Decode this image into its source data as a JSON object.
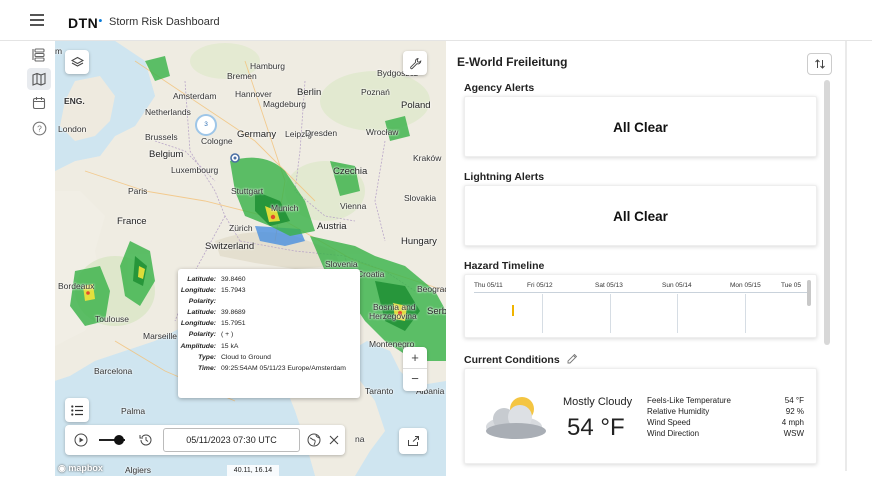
{
  "app": {
    "logo": "DTN",
    "title": "Storm Risk Dashboard"
  },
  "nav": {
    "items": [
      {
        "icon": "layers-list-icon"
      },
      {
        "icon": "map-icon",
        "active": true
      },
      {
        "icon": "calendar-icon"
      },
      {
        "icon": "help-icon"
      }
    ]
  },
  "map": {
    "labels": {
      "hamburg": "Hamburg",
      "bremen": "Bremen",
      "amsterdam": "Amsterdam",
      "hannover": "Hannover",
      "berlin": "Berlin",
      "magdeburg": "Magdeburg",
      "netherlands": "Netherlands",
      "poznan": "Poznań",
      "bydgoszcz": "Bydgoszcz",
      "poland": "Poland",
      "london": "London",
      "eng": "ENG.",
      "brussels": "Brussels",
      "germany": "Germany",
      "cologne": "Cologne",
      "leipzig": "Leipzig",
      "dresden": "Dresden",
      "wroclaw": "Wrocław",
      "belgium": "Belgium",
      "luxembourg": "Luxembourg",
      "czechia": "Czechia",
      "krakow": "Kraków",
      "paris": "Paris",
      "stuttgart": "Stuttgart",
      "munich": "Munich",
      "vienna": "Vienna",
      "slovakia": "Slovakia",
      "france": "France",
      "zurich": "Zürich",
      "austria": "Austria",
      "switzerland": "Switzerland",
      "hungary": "Hungary",
      "bordeaux": "Bordeaux",
      "toulouse": "Toulouse",
      "marseille": "Marseille",
      "slovenia": "Slovenia",
      "croatia": "Croatia",
      "beograd": "Beograd",
      "bosnia": "Bosnia and",
      "herzegovina": "Herzegovina",
      "serb": "Serb",
      "montenegro": "Montenegro",
      "barcelona": "Barcelona",
      "palma": "Palma",
      "algiers": "Algiers",
      "albania": "Albania",
      "taranto": "Taranto",
      "na": "na",
      "m": "m"
    },
    "cluster_count": "3",
    "popup": [
      {
        "key": "Latitude:",
        "value": "39.8460"
      },
      {
        "key": "Longitude:",
        "value": "15.7943"
      },
      {
        "key": "Polarity:",
        "value": ""
      },
      {
        "key": "Latitude:",
        "value": "39.8689"
      },
      {
        "key": "Longitude:",
        "value": "15.7951"
      },
      {
        "key": "Polarity:",
        "value": "( + )"
      },
      {
        "key": "Amplitude:",
        "value": "15 kA"
      },
      {
        "key": "Type:",
        "value": "Cloud to Ground"
      },
      {
        "key": "Time:",
        "value": "09:25:54AM 05/11/23 Europe/Amsterdam"
      }
    ],
    "player": {
      "datetime": "05/11/2023 07:30 UTC",
      "slider_position": 0.75
    },
    "coords": "40.11, 16.14",
    "attribution": "mapbox"
  },
  "panel": {
    "title": "E-World Freileitung",
    "agency": {
      "heading": "Agency Alerts",
      "status": "All Clear"
    },
    "lightning": {
      "heading": "Lightning Alerts",
      "status": "All Clear"
    },
    "timeline": {
      "heading": "Hazard Timeline",
      "days": [
        "Thu 05/11",
        "Fri 05/12",
        "Sat 05/13",
        "Sun 05/14",
        "Mon 05/15",
        "Tue 05"
      ]
    },
    "conditions": {
      "heading": "Current Conditions",
      "summary": "Mostly Cloudy",
      "temperature": "54 °F",
      "rows": [
        {
          "label": "Feels-Like Temperature",
          "value": "54  °F"
        },
        {
          "label": "Relative Humidity",
          "value": "92  %"
        },
        {
          "label": "Wind Speed",
          "value": "4  mph"
        },
        {
          "label": "Wind Direction",
          "value": "WSW"
        }
      ]
    }
  },
  "colors": {
    "accent": "#0a7bd8",
    "timeline_marker": "#f0b400",
    "radar_green": "#3bb34a",
    "radar_yellow": "#f2e33a"
  }
}
